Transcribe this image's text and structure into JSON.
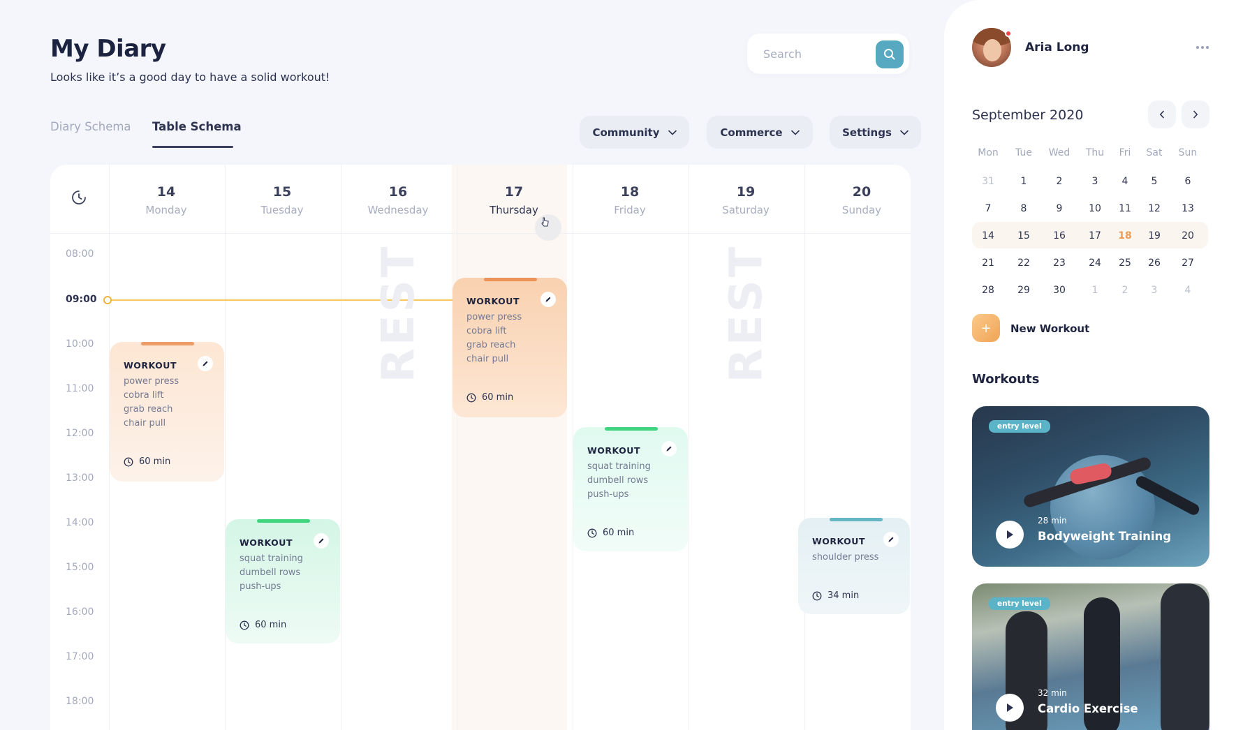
{
  "header": {
    "title": "My Diary",
    "subtitle": "Looks like it’s a good day to have a solid workout!",
    "search_placeholder": "Search"
  },
  "tabs": [
    {
      "label": "Diary Schema",
      "active": false
    },
    {
      "label": "Table Schema",
      "active": true
    }
  ],
  "dropdowns": [
    {
      "label": "Community"
    },
    {
      "label": "Commerce"
    },
    {
      "label": "Settings"
    }
  ],
  "week": {
    "days": [
      {
        "num": "14",
        "name": "Monday"
      },
      {
        "num": "15",
        "name": "Tuesday"
      },
      {
        "num": "16",
        "name": "Wednesday"
      },
      {
        "num": "17",
        "name": "Thursday"
      },
      {
        "num": "18",
        "name": "Friday"
      },
      {
        "num": "19",
        "name": "Saturday"
      },
      {
        "num": "20",
        "name": "Sunday"
      }
    ],
    "hours": [
      "08:00",
      "09:00",
      "10:00",
      "11:00",
      "12:00",
      "13:00",
      "14:00",
      "15:00",
      "16:00",
      "17:00",
      "18:00"
    ],
    "current_time": "09:00",
    "rest_label": "REST",
    "workouts": [
      {
        "title": "WORKOUT",
        "exercises": [
          "power press",
          "cobra lift",
          "grab reach",
          "chair pull"
        ],
        "duration": "60 min"
      },
      {
        "title": "WORKOUT",
        "exercises": [
          "squat training",
          "dumbell rows",
          "push-ups"
        ],
        "duration": "60 min"
      },
      {
        "title": "WORKOUT",
        "exercises": [
          "power press",
          "cobra lift",
          "grab reach",
          "chair pull"
        ],
        "duration": "60 min"
      },
      {
        "title": "WORKOUT",
        "exercises": [
          "squat training",
          "dumbell rows",
          "push-ups"
        ],
        "duration": "60 min"
      },
      {
        "title": "WORKOUT",
        "exercises": [
          "shoulder press"
        ],
        "duration": "34 min"
      }
    ]
  },
  "user": {
    "name": "Aria Long"
  },
  "mini_calendar": {
    "month": "September 2020",
    "weekdays": [
      "Mon",
      "Tue",
      "Wed",
      "Thu",
      "Fri",
      "Sat",
      "Sun"
    ],
    "weeks": [
      [
        "31",
        "1",
        "2",
        "3",
        "4",
        "5",
        "6"
      ],
      [
        "7",
        "8",
        "9",
        "10",
        "11",
        "12",
        "13"
      ],
      [
        "14",
        "15",
        "16",
        "17",
        "18",
        "19",
        "20"
      ],
      [
        "21",
        "22",
        "23",
        "24",
        "25",
        "26",
        "27"
      ],
      [
        "28",
        "29",
        "30",
        "1",
        "2",
        "3",
        "4"
      ]
    ],
    "today": "18"
  },
  "new_workout_label": "New Workout",
  "workouts_title": "Workouts",
  "workout_cards": [
    {
      "badge": "entry level",
      "duration": "28 min",
      "name": "Bodyweight Training"
    },
    {
      "badge": "entry level",
      "duration": "32 min",
      "name": "Cardio Exercise"
    }
  ],
  "colors": {
    "accent_blue": "#56a9c1",
    "accent_orange": "#ee9b55",
    "now_line": "#f6c75a",
    "mint_bar": "#3fd47e"
  }
}
